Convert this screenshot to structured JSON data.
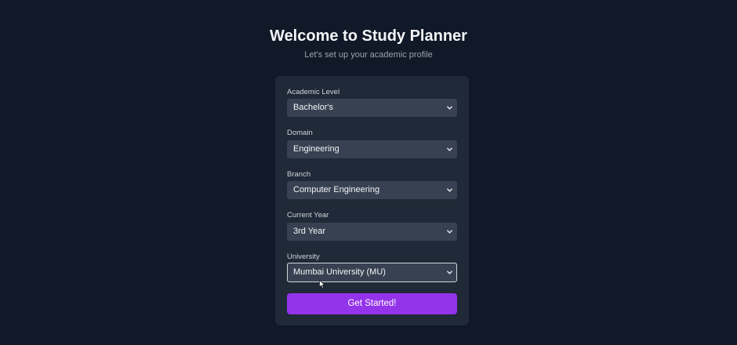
{
  "header": {
    "title": "Welcome to Study Planner",
    "subtitle": "Let's set up your academic profile"
  },
  "form": {
    "fields": [
      {
        "label": "Academic Level",
        "value": "Bachelor's"
      },
      {
        "label": "Domain",
        "value": "Engineering"
      },
      {
        "label": "Branch",
        "value": "Computer Engineering"
      },
      {
        "label": "Current Year",
        "value": "3rd Year"
      },
      {
        "label": "University",
        "value": "Mumbai University (MU)"
      }
    ],
    "submit_label": "Get Started!"
  },
  "colors": {
    "background": "#111827",
    "card": "#1f2937",
    "select": "#374151",
    "accent": "#9333ea"
  },
  "icons": {
    "select_chevron": "chevron-down-icon",
    "cursor": "mouse-pointer-icon"
  }
}
